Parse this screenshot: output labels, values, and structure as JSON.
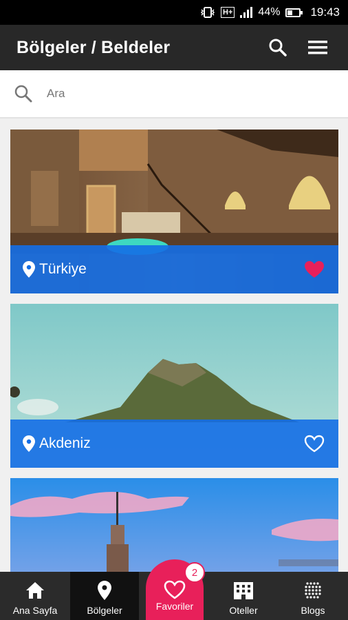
{
  "status_bar": {
    "battery": "44%",
    "battery_level": 0.44,
    "time": "19:43",
    "network": "H+",
    "icons": [
      "vibrate-icon",
      "network-icon",
      "signal-icon",
      "battery-icon"
    ]
  },
  "app_bar": {
    "title": "Bölgeler / Beldeler",
    "icons": [
      "search-icon",
      "menu-icon"
    ]
  },
  "search": {
    "placeholder": "Ara",
    "value": ""
  },
  "cards": [
    {
      "name": "Türkiye",
      "favorite": true
    },
    {
      "name": "Akdeniz",
      "favorite": false
    },
    {
      "name": "",
      "favorite": false
    }
  ],
  "bottom_nav": {
    "items": [
      {
        "label": "Ana Sayfa",
        "icon": "home-icon",
        "active": false
      },
      {
        "label": "Bölgeler",
        "icon": "location-pin-icon",
        "active": true
      },
      {
        "label": "Oteller",
        "icon": "hotel-icon",
        "active": false
      },
      {
        "label": "Blogs",
        "icon": "blogs-icon",
        "active": false
      }
    ],
    "favorites": {
      "label": "Favoriler",
      "count": "2",
      "icon": "heart-icon"
    }
  },
  "colors": {
    "accent": "#e8205a",
    "card_bar": "#146ee6",
    "app_bar": "#282828",
    "nav_bar": "#2b2b2b"
  }
}
